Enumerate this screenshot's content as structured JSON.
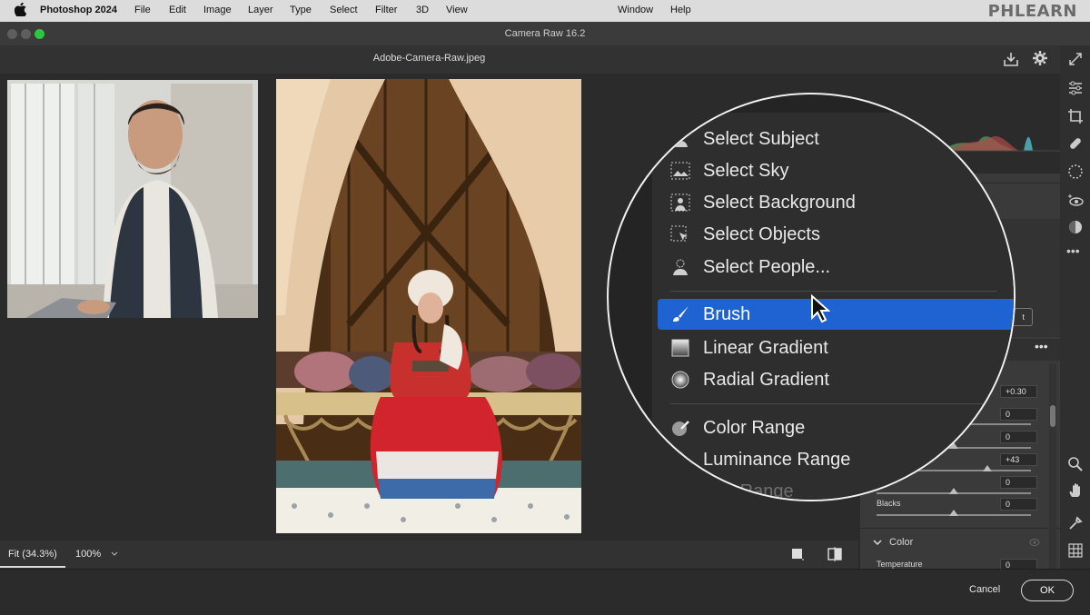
{
  "menubar": {
    "app": "Photoshop 2024",
    "items": [
      "File",
      "Edit",
      "Image",
      "Layer",
      "Type",
      "Select",
      "Filter",
      "3D",
      "View",
      "Window",
      "Help"
    ],
    "brand": "PHLEARN"
  },
  "window": {
    "title": "Camera Raw 16.2",
    "filename": "Adobe-Camera-Raw.jpeg"
  },
  "bottombar": {
    "zoom_fit": "Fit (34.3%)",
    "zoom_100": "100%"
  },
  "footer": {
    "cancel": "Cancel",
    "ok": "OK"
  },
  "mask_menu": {
    "items": [
      {
        "label": "Select Subject",
        "icon": "select-subject-icon"
      },
      {
        "label": "Select Sky",
        "icon": "select-sky-icon"
      },
      {
        "label": "Select Background",
        "icon": "select-background-icon"
      },
      {
        "label": "Select Objects",
        "icon": "select-objects-icon"
      },
      {
        "label": "Select People...",
        "icon": "select-people-icon"
      },
      {
        "label": "Brush",
        "icon": "brush-icon",
        "selected": true
      },
      {
        "label": "Linear Gradient",
        "icon": "linear-gradient-icon"
      },
      {
        "label": "Radial Gradient",
        "icon": "radial-gradient-icon"
      },
      {
        "label": "Color Range",
        "icon": "color-range-icon"
      },
      {
        "label": "Luminance Range",
        "icon": "luminance-range-icon"
      },
      {
        "label": "h Range",
        "icon": "depth-range-icon"
      }
    ],
    "selected_color": "#1f63d3"
  },
  "panel": {
    "values": {
      "v1": "+0.30",
      "v2": "0",
      "v3": "0",
      "v4": "+43",
      "v5": "0",
      "v6": "0"
    },
    "blacks_label": "Blacks",
    "color_section": "Color",
    "temperature_label": "Temperature",
    "temperature_value": "0",
    "button_fragment": "t"
  },
  "colors": {
    "accent": "#1f63d3",
    "panel_bg": "#3a3a3a",
    "canvas_bg": "#2b2b2b"
  }
}
